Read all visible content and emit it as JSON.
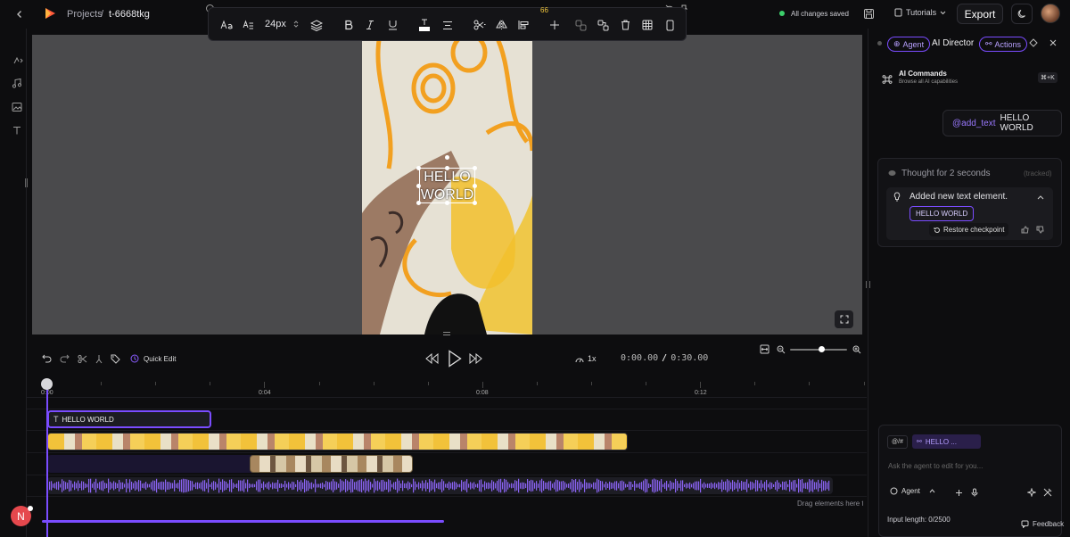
{
  "breadcrumb": {
    "root": "Projects",
    "separator": "/",
    "current": "t-6668tkg"
  },
  "header": {
    "status": "All changes saved",
    "tutorials": "Tutorials",
    "export": "Export",
    "status_color": "#3ccf6b"
  },
  "format_toolbar": {
    "font_size": "24px",
    "zoom_value": "66"
  },
  "canvas": {
    "text_line1": "HELLO",
    "text_line2": "WORLD"
  },
  "rail": {
    "icons": [
      "chevron-right-icon",
      "music-icon",
      "image-icon",
      "text-icon"
    ]
  },
  "agent_panel": {
    "tab_agent": "Agent",
    "title": "AI Director",
    "tab_actions": "Actions",
    "commands_title": "AI Commands",
    "commands_subtitle": "Browse all AI capabilities",
    "shortcut": "⌘+K",
    "user_message_mention": "@add_text",
    "user_message_text": "HELLO WORLD",
    "thought": "Thought for 2 seconds",
    "tracked": "(tracked)",
    "result_text": "Added new text element.",
    "result_chip": "HELLO WORLD",
    "restore": "Restore checkpoint",
    "mention_btn": "@/#",
    "input_chip": "HELLO ...",
    "input_placeholder": "Ask the agent to edit for you...",
    "mode": "Agent",
    "input_length": "Input length: 0/2500",
    "feedback": "Feedback",
    "accent": "#7a4cff"
  },
  "timeline": {
    "quick_edit": "Quick Edit",
    "speed": "1x",
    "time_current": "0:00.00",
    "time_sep": "/",
    "time_total": "0:30.00",
    "ticks": [
      "0:00",
      "0:04",
      "0:08",
      "0:12"
    ],
    "text_clip": "HELLO WORLD",
    "drag_hint": "Drag elements here t",
    "zoom_level": 0.55,
    "progress_bar_fraction": 0.49
  },
  "avatar_letter": "N"
}
